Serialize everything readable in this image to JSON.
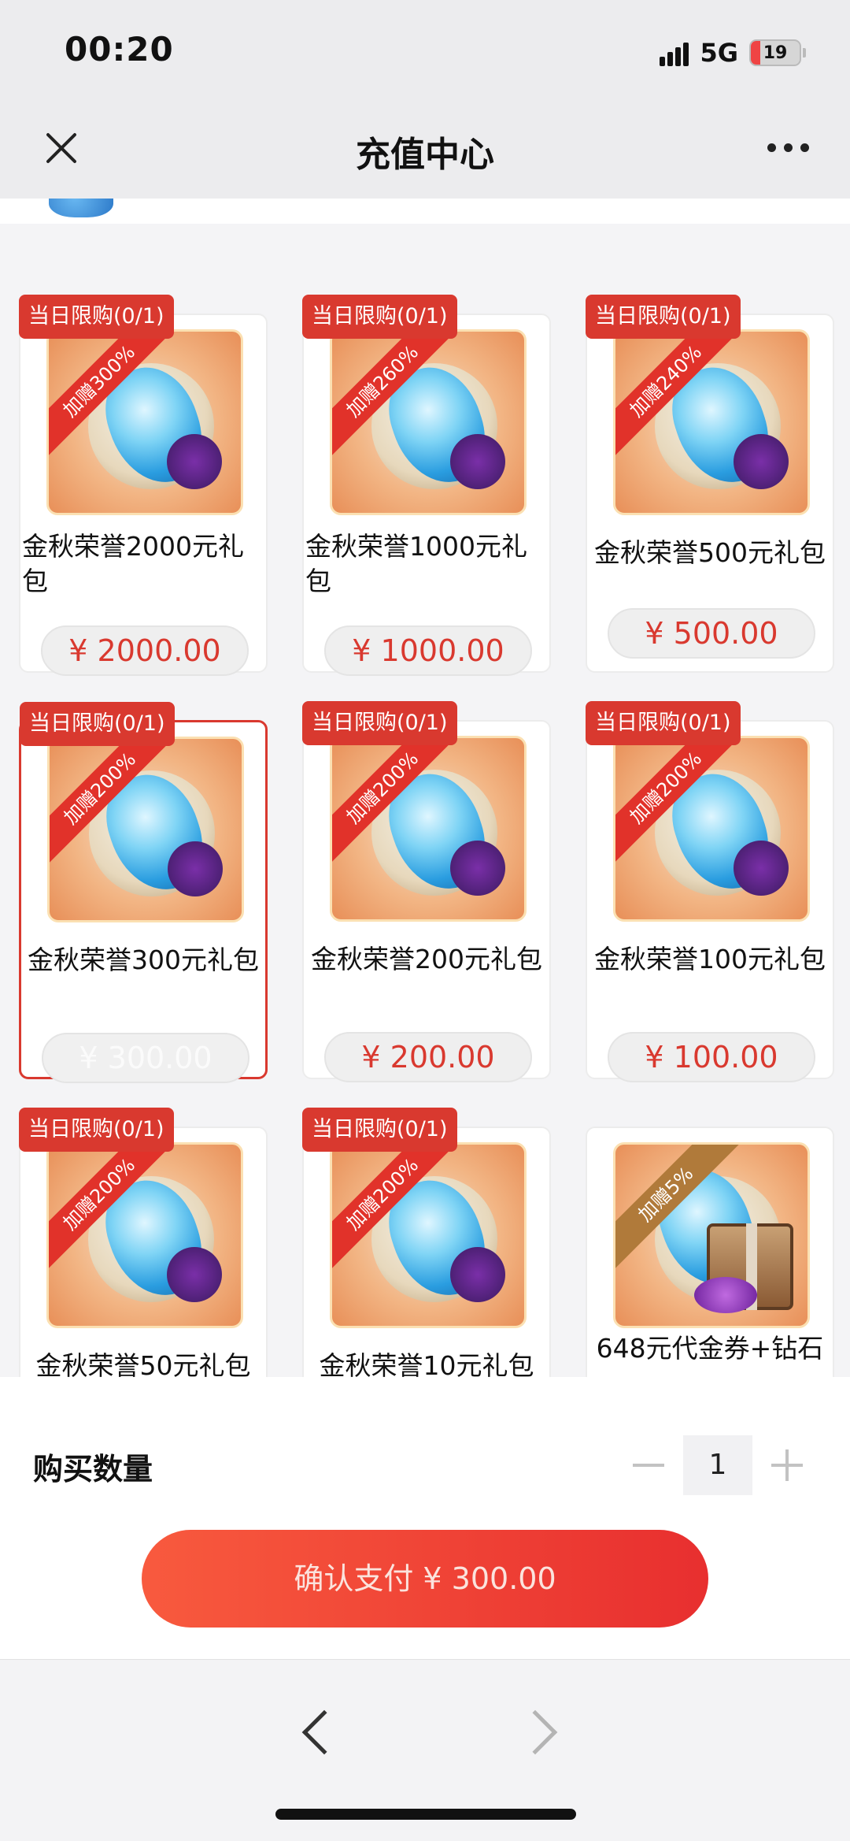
{
  "status": {
    "time": "00:20",
    "network": "5G",
    "battery": "19",
    "battery_level": 0.19
  },
  "header": {
    "title": "充值中心"
  },
  "products": [
    {
      "badge": "当日限购(0/1)",
      "ribbon": "加赠300%",
      "name": "金秋荣誉2000元礼包",
      "price": "¥ 2000.00"
    },
    {
      "badge": "当日限购(0/1)",
      "ribbon": "加赠260%",
      "name": "金秋荣誉1000元礼包",
      "price": "¥ 1000.00"
    },
    {
      "badge": "当日限购(0/1)",
      "ribbon": "加赠240%",
      "name": "金秋荣誉500元礼包",
      "price": "¥ 500.00"
    },
    {
      "badge": "当日限购(0/1)",
      "ribbon": "加赠200%",
      "name": "金秋荣誉300元礼包",
      "price": "¥ 300.00",
      "selected": true
    },
    {
      "badge": "当日限购(0/1)",
      "ribbon": "加赠200%",
      "name": "金秋荣誉200元礼包",
      "price": "¥ 200.00"
    },
    {
      "badge": "当日限购(0/1)",
      "ribbon": "加赠200%",
      "name": "金秋荣誉100元礼包",
      "price": "¥ 100.00"
    },
    {
      "badge": "当日限购(0/1)",
      "ribbon": "加赠200%",
      "name": "金秋荣誉50元礼包"
    },
    {
      "badge": "当日限购(0/1)",
      "ribbon": "加赠200%",
      "name": "金秋荣誉10元礼包"
    },
    {
      "ribbon": "加赠5%",
      "name": "648元代金券+钻石"
    }
  ],
  "quantity": {
    "label": "购买数量",
    "value": "1"
  },
  "pay_button": {
    "label": "确认支付 ¥ 300.00"
  },
  "colors": {
    "accent": "#d9392f",
    "pay_gradient_start": "#f85a3e",
    "pay_gradient_end": "#e82f2f"
  }
}
